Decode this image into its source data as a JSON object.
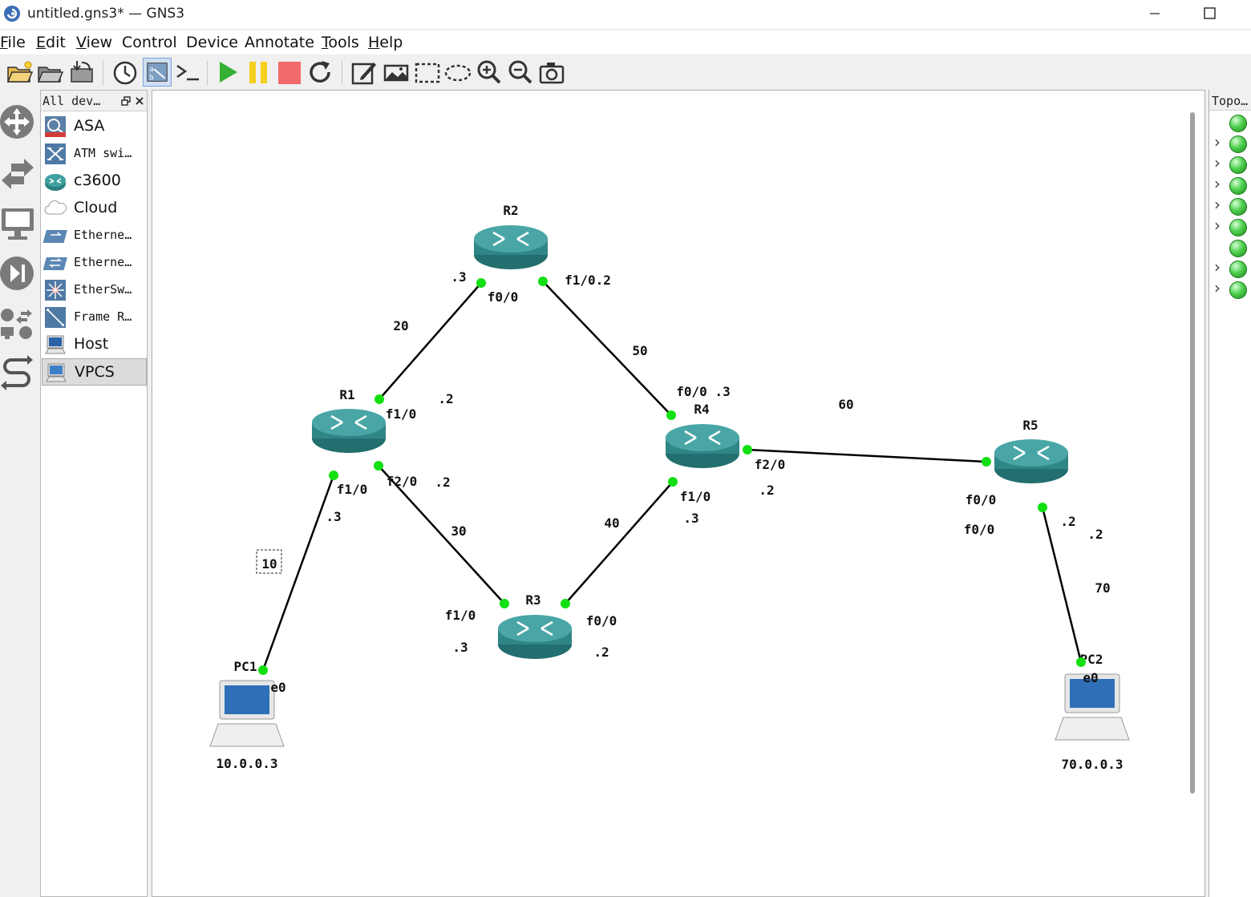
{
  "window": {
    "title": "untitled.gns3* — GNS3",
    "app_icon": "gns3-logo-icon",
    "minimize_icon": "minimize-icon",
    "maximize_icon": "maximize-icon"
  },
  "menu": [
    {
      "label": "File",
      "access": "F"
    },
    {
      "label": "Edit",
      "access": "E"
    },
    {
      "label": "View",
      "access": "V"
    },
    {
      "label": "Control",
      "access": ""
    },
    {
      "label": "Device",
      "access": ""
    },
    {
      "label": "Annotate",
      "access": ""
    },
    {
      "label": "Tools",
      "access": "T"
    },
    {
      "label": "Help",
      "access": "H"
    }
  ],
  "toolbar": [
    "new-project-icon",
    "open-project-icon",
    "save-project-icon",
    "snapshot-clock-icon",
    "show-interface-labels-icon",
    "console-all-icon",
    "start-all-icon",
    "suspend-all-icon",
    "stop-all-icon",
    "reload-all-icon",
    "add-note-icon",
    "insert-image-icon",
    "draw-rectangle-icon",
    "draw-ellipse-icon",
    "zoom-in-icon",
    "zoom-out-icon",
    "screenshot-icon"
  ],
  "left_rail": [
    "browse-routers-icon",
    "browse-switches-icon",
    "browse-end-devices-icon",
    "browse-security-icon",
    "browse-all-devices-icon",
    "add-link-icon"
  ],
  "devices_panel": {
    "title": "All dev…",
    "undock_icon": "undock-icon",
    "close_icon": "close-icon",
    "items": [
      {
        "label": "ASA",
        "icon": "asa-firewall-icon",
        "style": "sans"
      },
      {
        "label": "ATM swi…",
        "icon": "atm-switch-icon",
        "style": "mono"
      },
      {
        "label": "c3600",
        "icon": "router-icon",
        "style": "sans"
      },
      {
        "label": "Cloud",
        "icon": "cloud-icon",
        "style": "sans"
      },
      {
        "label": "Etherne…",
        "icon": "ethernet-hub-icon",
        "style": "mono"
      },
      {
        "label": "Etherne…",
        "icon": "ethernet-switch-icon",
        "style": "mono"
      },
      {
        "label": "EtherSw…",
        "icon": "etherswitch-router-icon",
        "style": "mono"
      },
      {
        "label": "Frame R…",
        "icon": "frame-relay-switch-icon",
        "style": "mono"
      },
      {
        "label": "Host",
        "icon": "host-icon",
        "style": "sans"
      },
      {
        "label": "VPCS",
        "icon": "vpcs-icon",
        "style": "sans",
        "selected": true
      }
    ]
  },
  "topology_panel": {
    "title": "Topo…",
    "rows": [
      {
        "expandable": false,
        "status": "started"
      },
      {
        "expandable": true,
        "status": "started"
      },
      {
        "expandable": true,
        "status": "started"
      },
      {
        "expandable": true,
        "status": "started"
      },
      {
        "expandable": true,
        "status": "started"
      },
      {
        "expandable": true,
        "status": "started"
      },
      {
        "expandable": false,
        "status": "started"
      },
      {
        "expandable": true,
        "status": "started"
      },
      {
        "expandable": true,
        "status": "started"
      }
    ]
  },
  "topology": {
    "nodes": [
      {
        "id": "R1",
        "label": "R1",
        "type": "router"
      },
      {
        "id": "R2",
        "label": "R2",
        "type": "router"
      },
      {
        "id": "R3",
        "label": "R3",
        "type": "router"
      },
      {
        "id": "R4",
        "label": "R4",
        "type": "router"
      },
      {
        "id": "R5",
        "label": "R5",
        "type": "router"
      },
      {
        "id": "PC1",
        "label": "PC1",
        "type": "vpcs",
        "caption": "10.0.0.3"
      },
      {
        "id": "PC2",
        "label": "PC2",
        "type": "vpcs",
        "caption": "70.0.0.3"
      }
    ],
    "links": [
      {
        "from": "R1",
        "to": "R2"
      },
      {
        "from": "R2",
        "to": "R4"
      },
      {
        "from": "R1",
        "to": "R3"
      },
      {
        "from": "R3",
        "to": "R4"
      },
      {
        "from": "R4",
        "to": "R5"
      },
      {
        "from": "R1",
        "to": "PC1"
      },
      {
        "from": "R5",
        "to": "PC2"
      }
    ],
    "annotations": [
      ".3",
      "f0/0",
      "f1/0.2",
      "20",
      "50",
      ".2",
      "f1/0",
      "f0/0 .3",
      "60",
      "f2/0",
      ".2",
      "f0/0",
      ".2",
      "f2/0",
      ".2",
      "30",
      "40",
      "f1/0",
      ".3",
      "f0/0",
      ".3",
      "f1/0",
      ".2",
      "10",
      "70",
      "f1/0",
      ".3",
      "f0/0",
      ".2",
      "e0",
      "e0"
    ],
    "boxed_annotation": "10"
  }
}
